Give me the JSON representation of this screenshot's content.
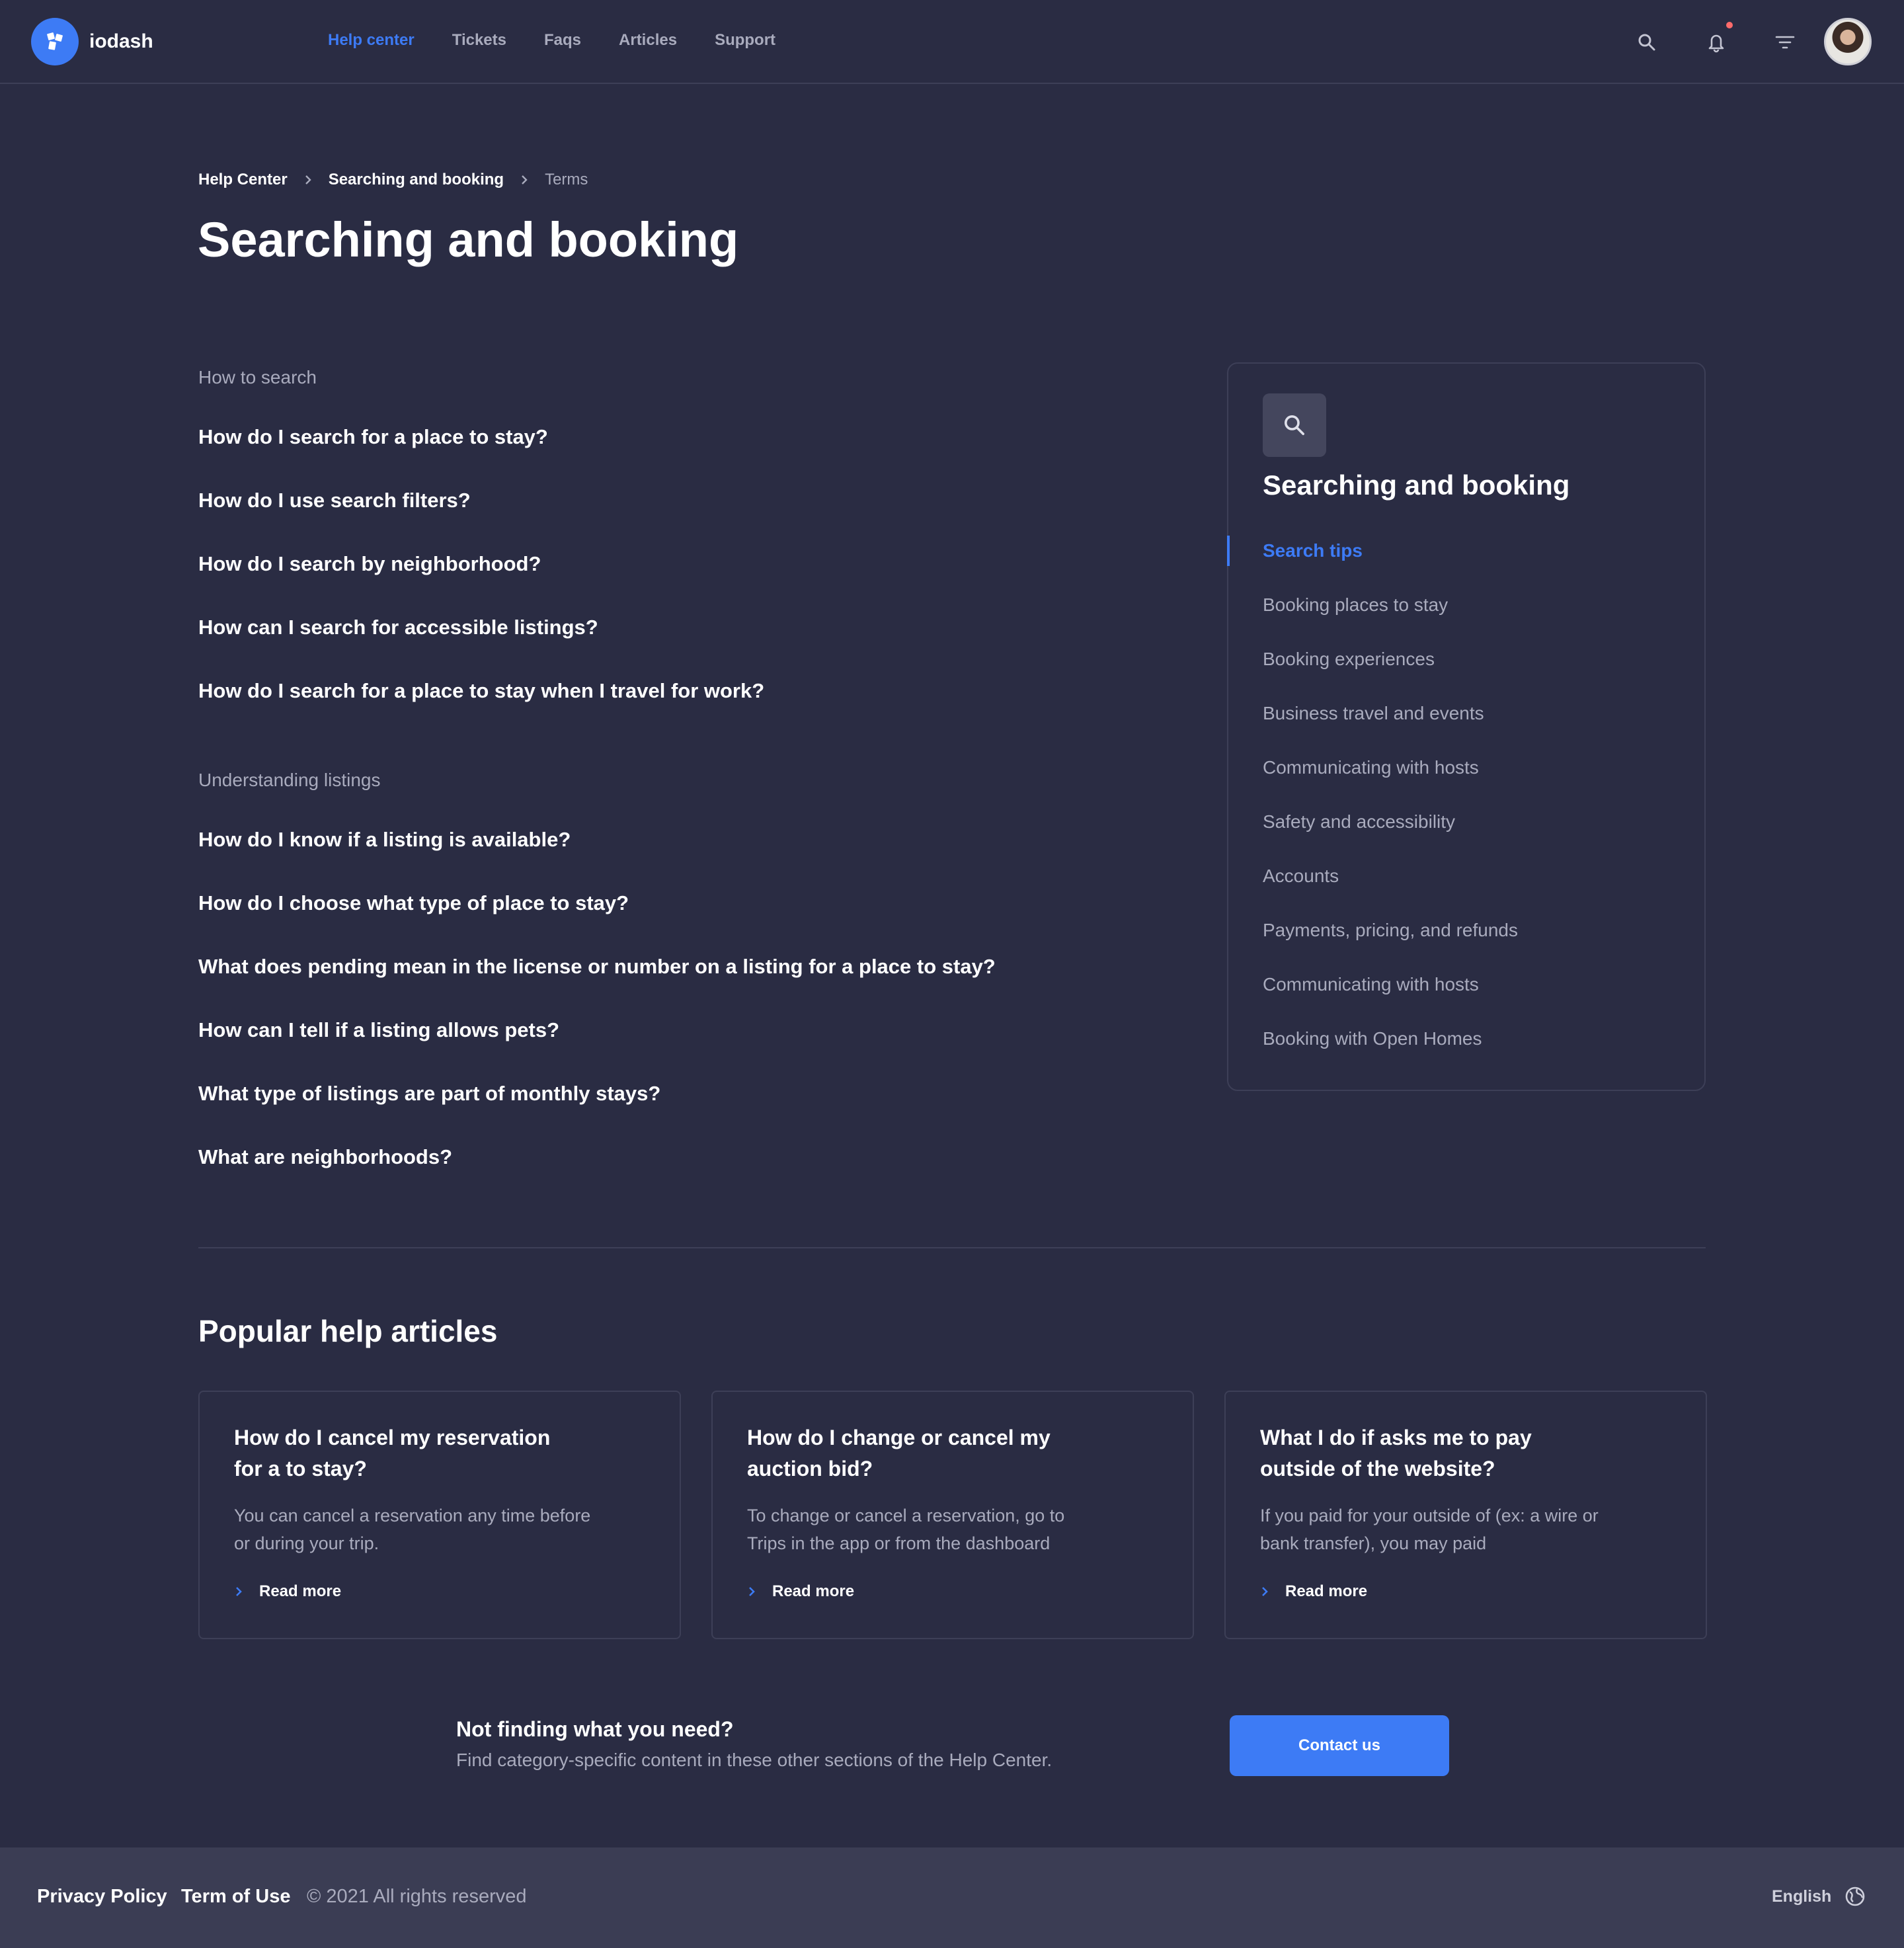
{
  "app": {
    "name": "iodash"
  },
  "nav": {
    "items": [
      {
        "label": "Help center",
        "active": true
      },
      {
        "label": "Tickets"
      },
      {
        "label": "Faqs"
      },
      {
        "label": "Articles"
      },
      {
        "label": "Support"
      }
    ]
  },
  "header_icons": [
    "search-icon",
    "bell-icon",
    "filter-icon",
    "avatar"
  ],
  "breadcrumb": [
    "Help Center",
    "Searching and booking",
    "Terms"
  ],
  "page_title": "Searching and booking",
  "sections": [
    {
      "heading": "How to search",
      "questions": [
        "How do I search for a place to stay?",
        "How do I use search filters?",
        "How do I search by neighborhood?",
        "How can I search for accessible listings?",
        "How do I search for a place to stay when I travel for work?"
      ]
    },
    {
      "heading": "Understanding listings",
      "questions": [
        "How do I know if a listing is available?",
        "How do I choose what type of place to stay?",
        "What does pending mean in the license or number on a listing for a place to stay?",
        "How can I tell if a listing allows pets?",
        "What type of listings are part of monthly stays?",
        "What are neighborhoods?"
      ]
    }
  ],
  "sidebar": {
    "title": "Searching and booking",
    "items": [
      {
        "label": "Search tips",
        "active": true
      },
      {
        "label": "Booking places to stay"
      },
      {
        "label": "Booking experiences"
      },
      {
        "label": "Business travel and events"
      },
      {
        "label": "Communicating with hosts"
      },
      {
        "label": "Safety and accessibility"
      },
      {
        "label": "Accounts"
      },
      {
        "label": "Payments, pricing, and refunds"
      },
      {
        "label": "Communicating with hosts"
      },
      {
        "label": "Booking with Open Homes"
      }
    ]
  },
  "popular": {
    "title": "Popular help articles",
    "articles": [
      {
        "title": "How do I cancel my reservation for a to stay?",
        "text": "You can cancel a reservation any time before or during your trip.",
        "link": "Read more"
      },
      {
        "title": "How do I change or cancel my auction bid?",
        "text": "To change or cancel a reservation, go to Trips in the app or from the dashboard",
        "link": "Read more"
      },
      {
        "title": "What I do if asks me to pay outside of the website?",
        "text": "If you paid for your outside of (ex: a wire or bank transfer), you may paid",
        "link": "Read more"
      }
    ]
  },
  "cta": {
    "title": "Not finding what you need?",
    "text": "Find category-specific content in these other sections of the Help Center.",
    "button": "Contact us"
  },
  "footer": {
    "privacy": "Privacy Policy",
    "terms": "Term of Use",
    "copyright": "© 2021 All rights reserved",
    "language": "English"
  },
  "colors": {
    "background": "#2a2c43",
    "accent": "#3d7bf5",
    "footer": "#3b3d54",
    "muted": "#a9abbd"
  }
}
